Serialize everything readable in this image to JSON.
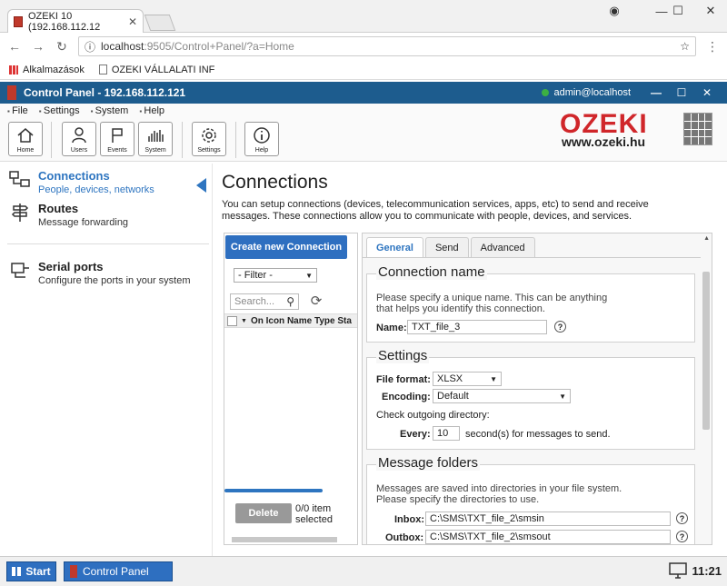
{
  "browser": {
    "tab_title": "OZEKI 10 (192.168.112.12",
    "url_host": "localhost",
    "url_rest": ":9505/Control+Panel/?a=Home",
    "bookmarks": [
      "Alkalmazások",
      "OZEKI VÁLLALATI INF"
    ]
  },
  "app": {
    "title": "Control Panel - 192.168.112.121",
    "user": "admin@localhost",
    "menu": [
      "File",
      "Settings",
      "System",
      "Help"
    ],
    "toolbar": [
      "Home",
      "Users",
      "Events",
      "System",
      "Settings",
      "Help"
    ],
    "brand_word": "OZEKI",
    "brand_site": "www.ozeki.hu"
  },
  "sidebar": {
    "items": [
      {
        "title": "Connections",
        "desc": "People, devices, networks"
      },
      {
        "title": "Routes",
        "desc": "Message forwarding"
      },
      {
        "title": "Serial ports",
        "desc": "Configure the ports in your system"
      }
    ]
  },
  "main": {
    "title": "Connections",
    "description": "You can setup connections (devices, telecommunication services, apps, etc) to send and receive messages. These connections allow you to communicate with people, devices, and services."
  },
  "list": {
    "create_label": "Create new Connection",
    "filter_value": "- Filter -",
    "search_placeholder": "Search...",
    "columns": "On Icon Name Type Sta",
    "delete_label": "Delete",
    "selected_line1": "0/0 item",
    "selected_line2": "selected",
    "progress": 0.74
  },
  "detail": {
    "tabs": [
      "General",
      "Send",
      "Advanced"
    ],
    "conn_name": {
      "legend": "Connection name",
      "text1": "Please specify a unique name. This can be anything",
      "text2": "that helps you identify this connection.",
      "label": "Name:",
      "value": "TXT_file_3"
    },
    "settings": {
      "legend": "Settings",
      "format_label": "File format:",
      "format_value": "XLSX",
      "encoding_label": "Encoding:",
      "encoding_value": "Default",
      "check_text": "Check outgoing directory:",
      "every_label": "Every:",
      "every_value": "10",
      "every_suffix": "second(s) for messages to send."
    },
    "folders": {
      "legend": "Message folders",
      "text1": "Messages are saved into directories in your file system.",
      "text2": "Please specify the directories to use.",
      "inbox_label": "Inbox:",
      "inbox_value": "C:\\SMS\\TXT_file_2\\smsin",
      "outbox_label": "Outbox:",
      "outbox_value": "C:\\SMS\\TXT_file_2\\smsout"
    }
  },
  "taskbar": {
    "start": "Start",
    "item": "Control Panel",
    "clock": "11:21"
  }
}
